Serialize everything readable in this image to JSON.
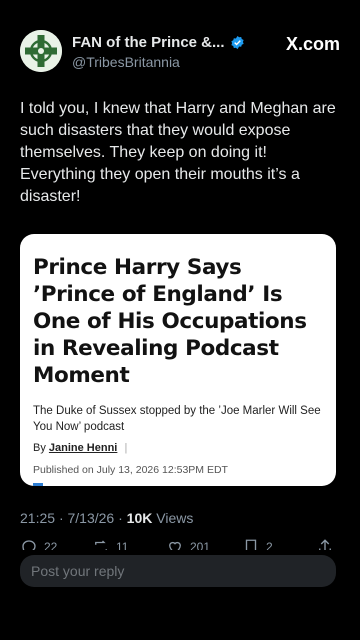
{
  "header": {
    "display_name": "FAN of the Prince &...",
    "handle": "@TribesBritannia",
    "brand": "X.com",
    "avatar_icon": "celtic-cross-icon",
    "verified_color": "#1d9bf0"
  },
  "tweet": {
    "text": "I told you, I knew that Harry and Meghan are such disasters that they would expose themselves. They keep on doing it! Everything they open their mouths it’s a disaster!"
  },
  "card": {
    "headline": "Prince Harry Says ’Prince of England’ Is One of His Occupations in Revealing Podcast Moment",
    "subhead": "The Duke of Sussex stopped by the ’Joe Marler Will See You Now’ podcast",
    "by_label": "By",
    "author": "Janine Henni",
    "published": "Published on July 13, 2026  12:53PM EDT"
  },
  "meta": {
    "time": "21:25",
    "date": "7/13/26",
    "views_count": "10K",
    "views_label": "Views"
  },
  "actions": [
    {
      "icon": "reply-icon",
      "count": "22"
    },
    {
      "icon": "retweet-icon",
      "count": "11"
    },
    {
      "icon": "like-icon",
      "count": "201"
    },
    {
      "icon": "bookmark-icon",
      "count": "2"
    },
    {
      "icon": "share-icon",
      "count": ""
    }
  ],
  "reply": {
    "placeholder": "Post your reply"
  }
}
